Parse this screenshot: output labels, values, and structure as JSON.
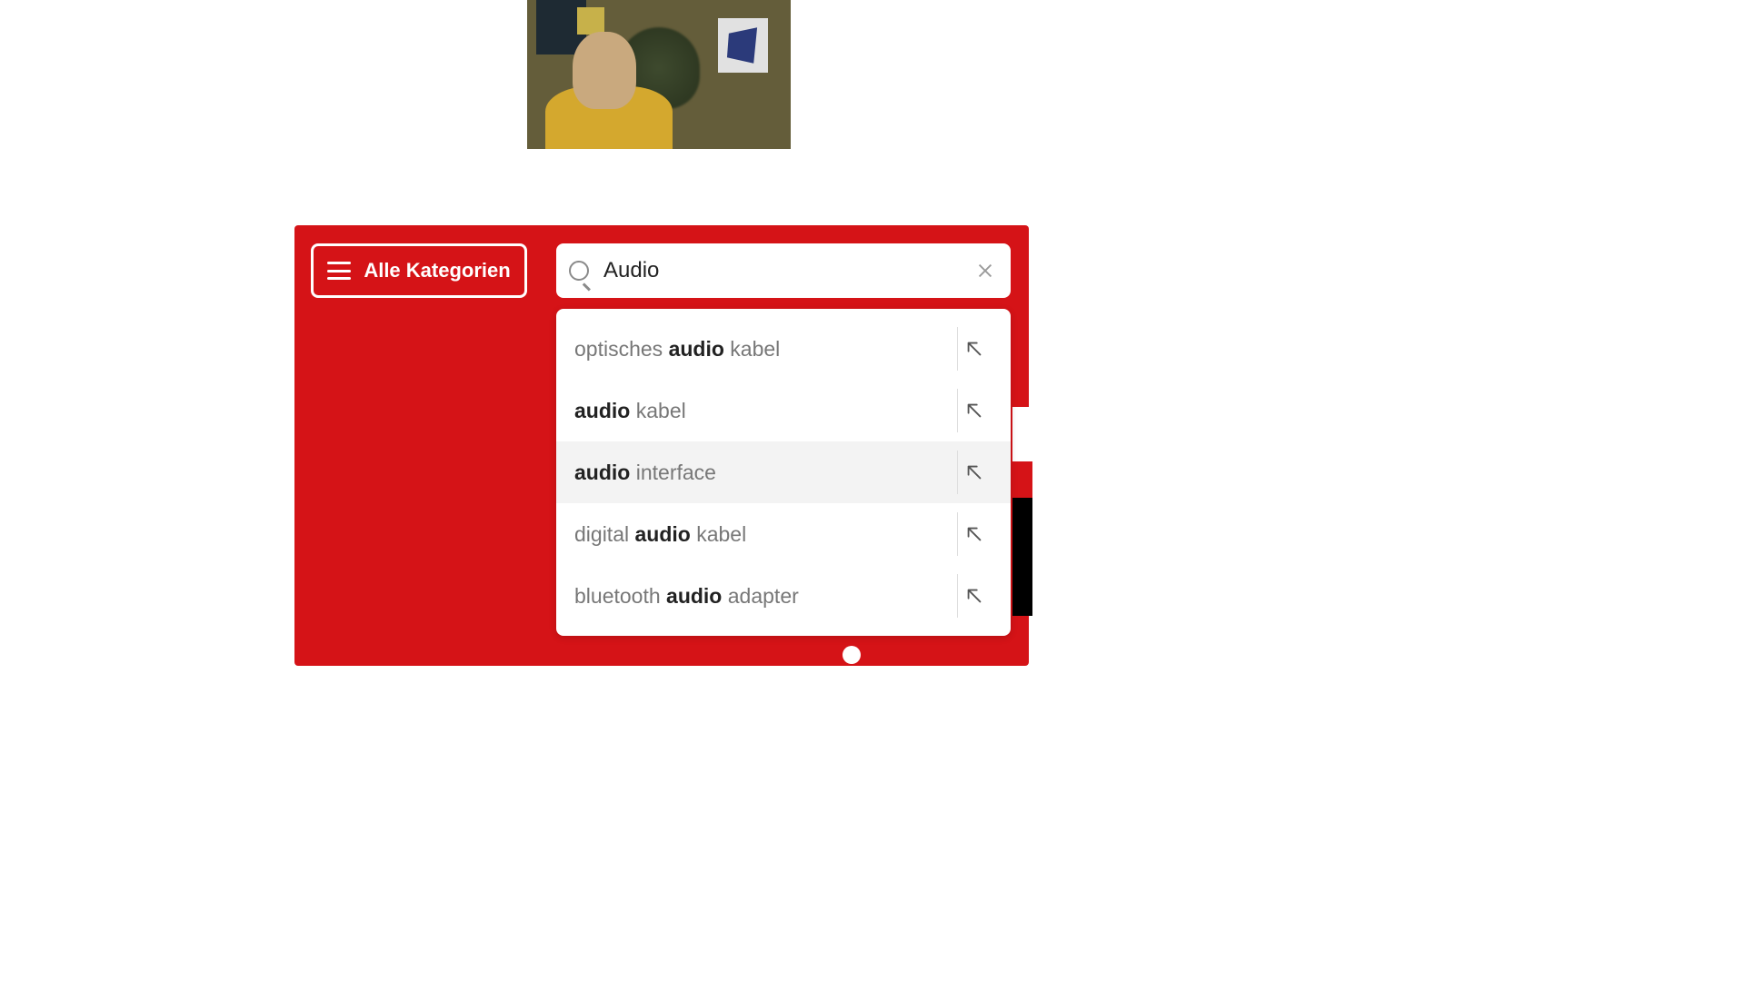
{
  "categories_label": "Alle Kategorien",
  "search": {
    "value": "Audio"
  },
  "suggestions": [
    {
      "pre": "optisches ",
      "match": "audio",
      "post": " kabel",
      "hover": false
    },
    {
      "pre": "",
      "match": "audio",
      "post": " kabel",
      "hover": false
    },
    {
      "pre": "",
      "match": "audio",
      "post": " interface",
      "hover": true
    },
    {
      "pre": "digital ",
      "match": "audio",
      "post": " kabel",
      "hover": false
    },
    {
      "pre": "bluetooth ",
      "match": "audio",
      "post": " adapter",
      "hover": false
    }
  ]
}
